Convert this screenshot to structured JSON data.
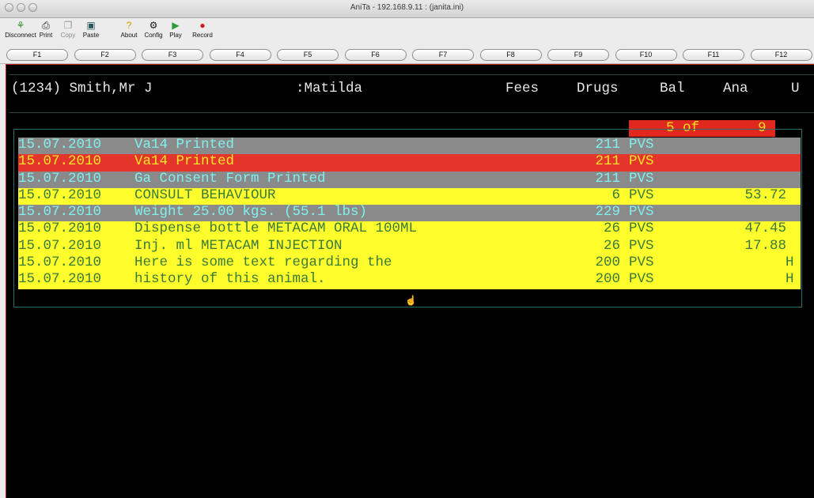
{
  "window": {
    "title": "AniTa - 192.168.9.11 : (janita.ini)"
  },
  "toolbar": [
    {
      "label": "Disconnect",
      "icon": "disconnect-icon",
      "glyph": "⚘",
      "enabled": true
    },
    {
      "label": "Print",
      "icon": "print-icon",
      "glyph": "⎙",
      "enabled": true
    },
    {
      "label": "Copy",
      "icon": "copy-icon",
      "glyph": "❐",
      "enabled": false
    },
    {
      "label": "Paste",
      "icon": "paste-icon",
      "glyph": "▣",
      "enabled": true
    },
    {
      "label": "About",
      "icon": "about-icon",
      "glyph": "?",
      "enabled": true
    },
    {
      "label": "Config",
      "icon": "config-icon",
      "glyph": "⚙",
      "enabled": true
    },
    {
      "label": "Play",
      "icon": "play-icon",
      "glyph": "▶",
      "enabled": true
    },
    {
      "label": "Record",
      "icon": "record-icon",
      "glyph": "●",
      "enabled": true
    }
  ],
  "fkeys": [
    "F1",
    "F2",
    "F3",
    "F4",
    "F5",
    "F6",
    "F7",
    "F8",
    "F9",
    "F10",
    "F11",
    "F12"
  ],
  "header": {
    "client": "(1234) Smith,Mr J",
    "animal": ":Matilda",
    "fees": "Fees",
    "drugs": "Drugs",
    "bal": "Bal",
    "ana": "Ana",
    "u": "U"
  },
  "counter": {
    "current": "5 of",
    "total": "9"
  },
  "rows": [
    {
      "date": "15.07.2010",
      "text": "Va14 Printed",
      "code": "211",
      "staff": "PVS",
      "amount": "",
      "flag": "",
      "style": "grey"
    },
    {
      "date": "15.07.2010",
      "text": "Va14 Printed",
      "code": "211",
      "staff": "PVS",
      "amount": "",
      "flag": "",
      "style": "red"
    },
    {
      "date": "15.07.2010",
      "text": "Ga Consent Form Printed",
      "code": "211",
      "staff": "PVS",
      "amount": "",
      "flag": "",
      "style": "grey"
    },
    {
      "date": "15.07.2010",
      "text": "CONSULT BEHAVIOUR",
      "code": "6",
      "staff": "PVS",
      "amount": "53.72",
      "flag": "",
      "style": "yellow"
    },
    {
      "date": "15.07.2010",
      "text": "Weight 25.00 kgs. (55.1 lbs)",
      "code": "229",
      "staff": "PVS",
      "amount": "",
      "flag": "",
      "style": "grey"
    },
    {
      "date": "15.07.2010",
      "text": "Dispense bottle METACAM ORAL 100ML",
      "code": "26",
      "staff": "PVS",
      "amount": "47.45",
      "flag": "",
      "style": "yellow"
    },
    {
      "date": "15.07.2010",
      "text": "Inj. ml METACAM INJECTION",
      "code": "26",
      "staff": "PVS",
      "amount": "17.88",
      "flag": "",
      "style": "yellow"
    },
    {
      "date": "15.07.2010",
      "text": "Here is some text regarding the",
      "code": "200",
      "staff": "PVS",
      "amount": "",
      "flag": "H",
      "style": "yellow"
    },
    {
      "date": "15.07.2010",
      "text": "history of this animal.",
      "code": "200",
      "staff": "PVS",
      "amount": "",
      "flag": "H",
      "style": "yellow"
    }
  ]
}
